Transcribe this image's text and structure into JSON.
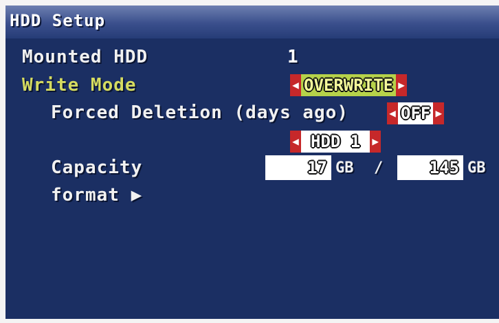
{
  "window": {
    "title": "HDD Setup"
  },
  "menu": {
    "mounted_hdd": {
      "label": "Mounted HDD",
      "value": "1"
    },
    "write_mode": {
      "label": "Write Mode",
      "value": "OVERWRITE",
      "selected": true
    },
    "forced_deletion": {
      "label": "Forced Deletion (days ago)",
      "value": "OFF"
    },
    "hdd_select": {
      "value": "HDD 1"
    },
    "capacity": {
      "label": "Capacity",
      "used": "17",
      "used_unit": "GB",
      "separator": "/",
      "total": "145",
      "total_unit": "GB"
    },
    "format": {
      "label": "format ▶"
    }
  },
  "icons": {
    "left_arrow": "◀",
    "right_arrow": "▶"
  },
  "colors": {
    "background": "#1b2f63",
    "title_bar": "#3a4f8c",
    "selected_label": "#d5db60",
    "arrow_red": "#c6282a",
    "active_value": "#b6d24a"
  }
}
